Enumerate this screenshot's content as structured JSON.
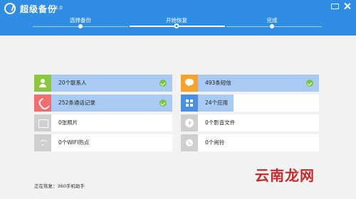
{
  "app": {
    "title": "超级备份",
    "version": "1.3.0"
  },
  "steps": [
    {
      "label": "选择备份",
      "state": "done"
    },
    {
      "label": "开始恢复",
      "state": "current"
    },
    {
      "label": "完成",
      "state": "pending"
    }
  ],
  "items": [
    {
      "label": "20个联系人",
      "icon": "person-icon",
      "icon_color": "#8dc63f",
      "progress": 1.0,
      "done": true
    },
    {
      "label": "493条短信",
      "icon": "message-icon",
      "icon_color": "#f7a32b",
      "progress": 1.0,
      "done": true
    },
    {
      "label": "252条通话记录",
      "icon": "phone-icon",
      "icon_color": "#f26d6d",
      "progress": 1.0,
      "done": true
    },
    {
      "label": "24个应用",
      "icon": "apps-icon",
      "icon_color": "#4a90e2",
      "progress": 0.25,
      "done": false
    },
    {
      "label": "0张照片",
      "icon": "picture-icon",
      "icon_color": "#cfcfcf",
      "progress": 0,
      "done": false
    },
    {
      "label": "0个影音文件",
      "icon": "play-icon",
      "icon_color": "#cfcfcf",
      "progress": 0,
      "done": false
    },
    {
      "label": "0个WIFI热点",
      "icon": "wifi-icon",
      "icon_color": "#cfcfcf",
      "progress": 0,
      "done": false
    },
    {
      "label": "0个闹铃",
      "icon": "alarm-icon",
      "icon_color": "#cfcfcf",
      "progress": 0,
      "done": false
    }
  ],
  "status": "正在恢复：360手机助手",
  "watermark": "云南龙网",
  "colors": {
    "header": "#2f8de4",
    "progress_fill": "#a9cbf3",
    "check": "#7bc342"
  }
}
